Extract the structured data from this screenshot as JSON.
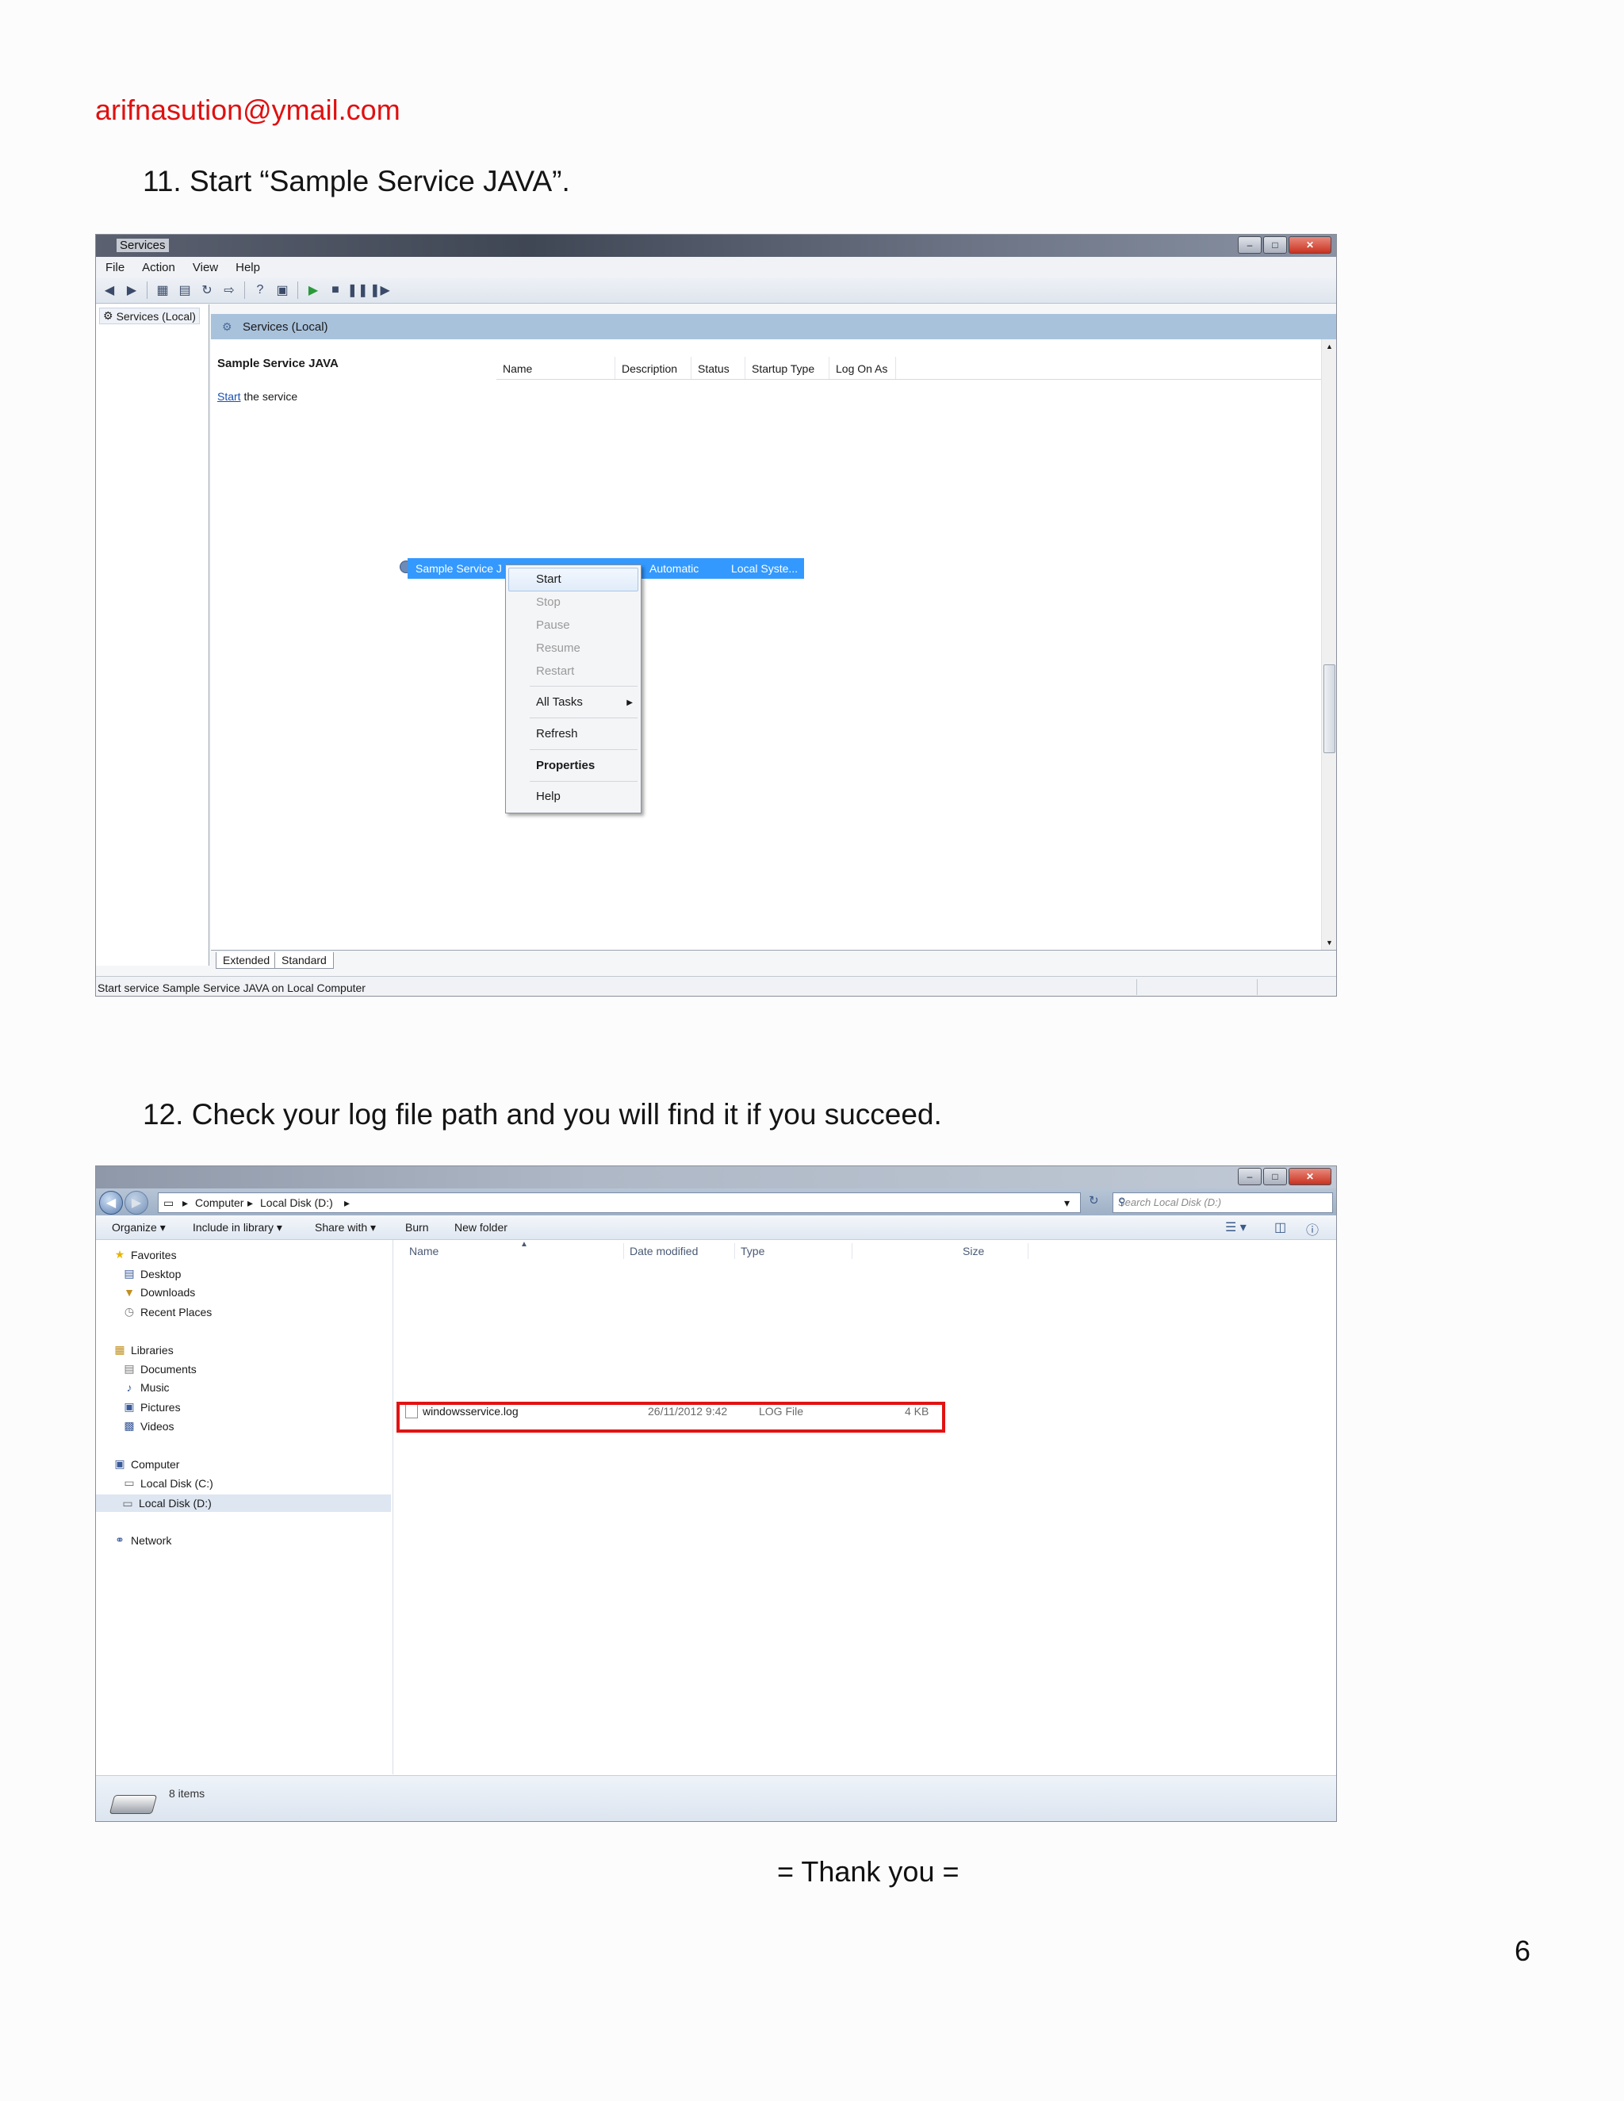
{
  "header": {
    "email": "arifnasution@ymail.com"
  },
  "steps": [
    {
      "text": "11.  Start “Sample Service JAVA”."
    },
    {
      "text": "12.  Check your log file path and you will find it if you succeed."
    }
  ],
  "footer": {
    "thanks": "= Thank you =",
    "page_number": "6"
  },
  "services_window": {
    "title": "Services",
    "menu": [
      "File",
      "Action",
      "View",
      "Help"
    ],
    "tree_node": "Services (Local)",
    "panel_header": "Services (Local)",
    "extended": {
      "title": "Sample Service JAVA",
      "link": "Start",
      "link_suffix": "the service"
    },
    "columns": [
      "Name",
      "Description",
      "Status",
      "Startup Type",
      "Log On As"
    ],
    "selected_row": {
      "name": "Sample Service J",
      "startup_type": "Automatic",
      "log_on_as": "Local Syste..."
    },
    "context_menu": {
      "start": "Start",
      "stop": "Stop",
      "pause": "Pause",
      "resume": "Resume",
      "restart": "Restart",
      "all_tasks": "All Tasks",
      "refresh": "Refresh",
      "properties": "Properties",
      "help": "Help"
    },
    "tabs": [
      "Extended",
      "Standard"
    ],
    "status_text": "Start service Sample Service JAVA on Local Computer"
  },
  "explorer_window": {
    "breadcrumb": [
      "Computer",
      "Local Disk (D:)"
    ],
    "search_placeholder": "Search Local Disk (D:)",
    "commands": {
      "organize": "Organize",
      "include": "Include in library",
      "share": "Share with",
      "burn": "Burn",
      "new_folder": "New folder"
    },
    "nav": {
      "favorites": "Favorites",
      "desktop": "Desktop",
      "downloads": "Downloads",
      "recent": "Recent Places",
      "libraries": "Libraries",
      "documents": "Documents",
      "music": "Music",
      "pictures": "Pictures",
      "videos": "Videos",
      "computer": "Computer",
      "disk_c": "Local Disk (C:)",
      "disk_d": "Local Disk (D:)",
      "network": "Network"
    },
    "columns": [
      "Name",
      "Date modified",
      "Type",
      "Size"
    ],
    "file": {
      "name": "windowsservice.log",
      "date": "26/11/2012 9:42",
      "type": "LOG File",
      "size": "4 KB"
    },
    "status_items": "8 items",
    "highlight_color": "#e11313"
  }
}
